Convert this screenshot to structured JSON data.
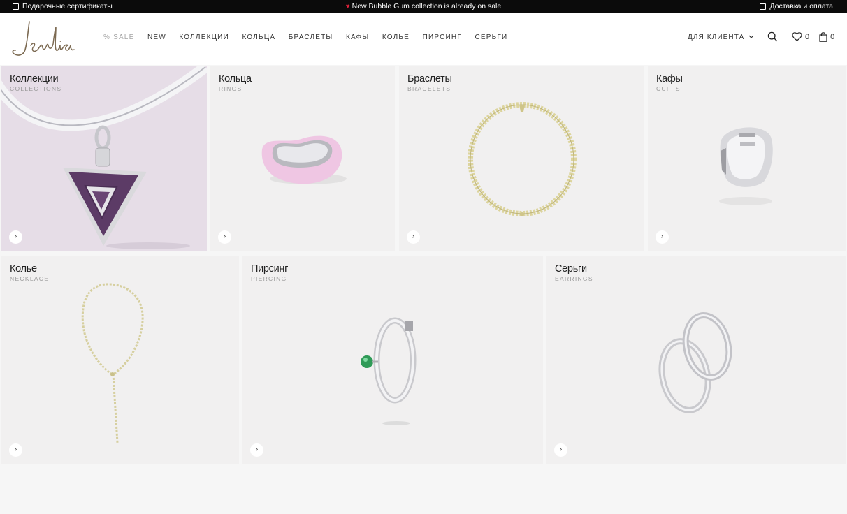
{
  "topbar": {
    "gift_label": "Подарочные сертификаты",
    "promo_label": "New Bubble Gum collection is already on sale",
    "delivery_label": "Доставка и оплата"
  },
  "header": {
    "logo_text": "Jewlia",
    "nav": [
      "% SALE",
      "NEW",
      "КОЛЛЕКЦИИ",
      "КОЛЬЦА",
      "БРАСЛЕТЫ",
      "КАФЫ",
      "КОЛЬЕ",
      "ПИРСИНГ",
      "СЕРЬГИ"
    ],
    "client_label": "ДЛЯ КЛИЕНТА",
    "wishlist_count": "0",
    "cart_count": "0"
  },
  "categories": [
    {
      "title": "Коллекции",
      "subtitle": "COLLECTIONS",
      "arrow": "›"
    },
    {
      "title": "Кольца",
      "subtitle": "RINGS",
      "arrow": "›"
    },
    {
      "title": "Браслеты",
      "subtitle": "BRACELETS",
      "arrow": "›"
    },
    {
      "title": "Кафы",
      "subtitle": "CUFFS",
      "arrow": "›"
    },
    {
      "title": "Колье",
      "subtitle": "NECKLACE",
      "arrow": "›"
    },
    {
      "title": "Пирсинг",
      "subtitle": "PIERCING",
      "arrow": "›"
    },
    {
      "title": "Серьги",
      "subtitle": "EARRINGS",
      "arrow": "›"
    }
  ],
  "colors": {
    "topbar_bg": "#0b0b0b",
    "tile_bg": "#f1f0f0",
    "collections_bg": "#e5dde6",
    "accent_heart": "#e0213a",
    "gold": "#d9d19a",
    "silver": "#c9c9cc",
    "purple": "#5a3a63",
    "emerald": "#2f9a57"
  }
}
